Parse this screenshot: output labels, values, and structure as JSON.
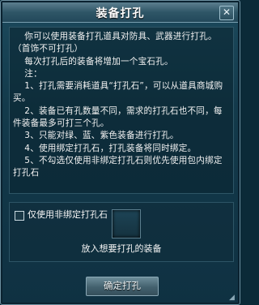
{
  "window": {
    "title": "装备打孔",
    "close_label": "✕"
  },
  "description": {
    "text": "    你可以使用装备打孔道具对防具、武器进行打孔。（首饰不可打孔）\n    每次打孔后的装备将增加一个宝石孔。\n    注：\n    1、打孔需要消耗道具“打孔石”，可以从道具商城购买。\n    2、装备已有孔数量不同，需求的打孔石也不同，每件装备最多可打三个孔。\n    3、只能对绿、蓝、紫色装备进行打孔。\n    4、使用绑定打孔石，打孔装备将同时绑定。\n    5、不勾选仅使用非绑定打孔石则优先使用包内绑定打孔石"
  },
  "options": {
    "checkbox_label": "仅使用非绑定打孔石",
    "checkbox_checked": false,
    "slot_label": "放入想要打孔的装备"
  },
  "actions": {
    "confirm_label": "确定打孔"
  },
  "colors": {
    "panel_bg": "#133a4b",
    "title_bar": "#2f5667",
    "text": "#f2f2f2",
    "border": "#6c8fa0"
  }
}
